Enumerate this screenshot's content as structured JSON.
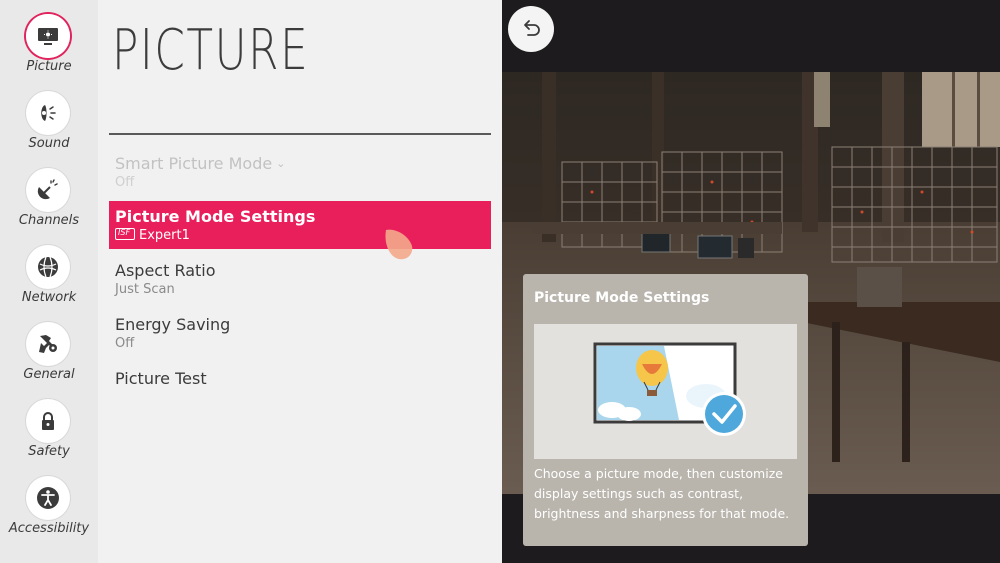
{
  "sidebar": {
    "items": [
      {
        "label": "Picture",
        "icon": "picture-icon",
        "active": true
      },
      {
        "label": "Sound",
        "icon": "sound-icon"
      },
      {
        "label": "Channels",
        "icon": "channels-icon"
      },
      {
        "label": "Network",
        "icon": "network-icon"
      },
      {
        "label": "General",
        "icon": "general-icon"
      },
      {
        "label": "Safety",
        "icon": "lock-icon"
      },
      {
        "label": "Accessibility",
        "icon": "accessibility-icon"
      }
    ]
  },
  "menu": {
    "title": "PICTURE",
    "items": [
      {
        "name": "Smart Picture Mode",
        "value": "Off",
        "state": "disabled",
        "has_dropdown": true
      },
      {
        "name": "Picture Mode Settings",
        "value": "Expert1",
        "state": "selected",
        "badge_icon": "isf-badge-icon"
      },
      {
        "name": "Aspect Ratio",
        "value": "Just Scan"
      },
      {
        "name": "Energy Saving",
        "value": "Off"
      },
      {
        "name": "Picture Test",
        "value": ""
      }
    ]
  },
  "tv": {
    "back_icon": "back-arrow-icon"
  },
  "help": {
    "title": "Picture Mode Settings",
    "text": "Choose a picture mode, then customize display settings such as contrast, brightness and sharpness for that mode.",
    "illustration_icon": "picture-mode-illustration"
  },
  "colors": {
    "accent": "#e91f5c",
    "sidebar_bg": "#e9e9e9",
    "menu_bg": "#f1f1f1",
    "help_bg": "#b9b5ad"
  }
}
